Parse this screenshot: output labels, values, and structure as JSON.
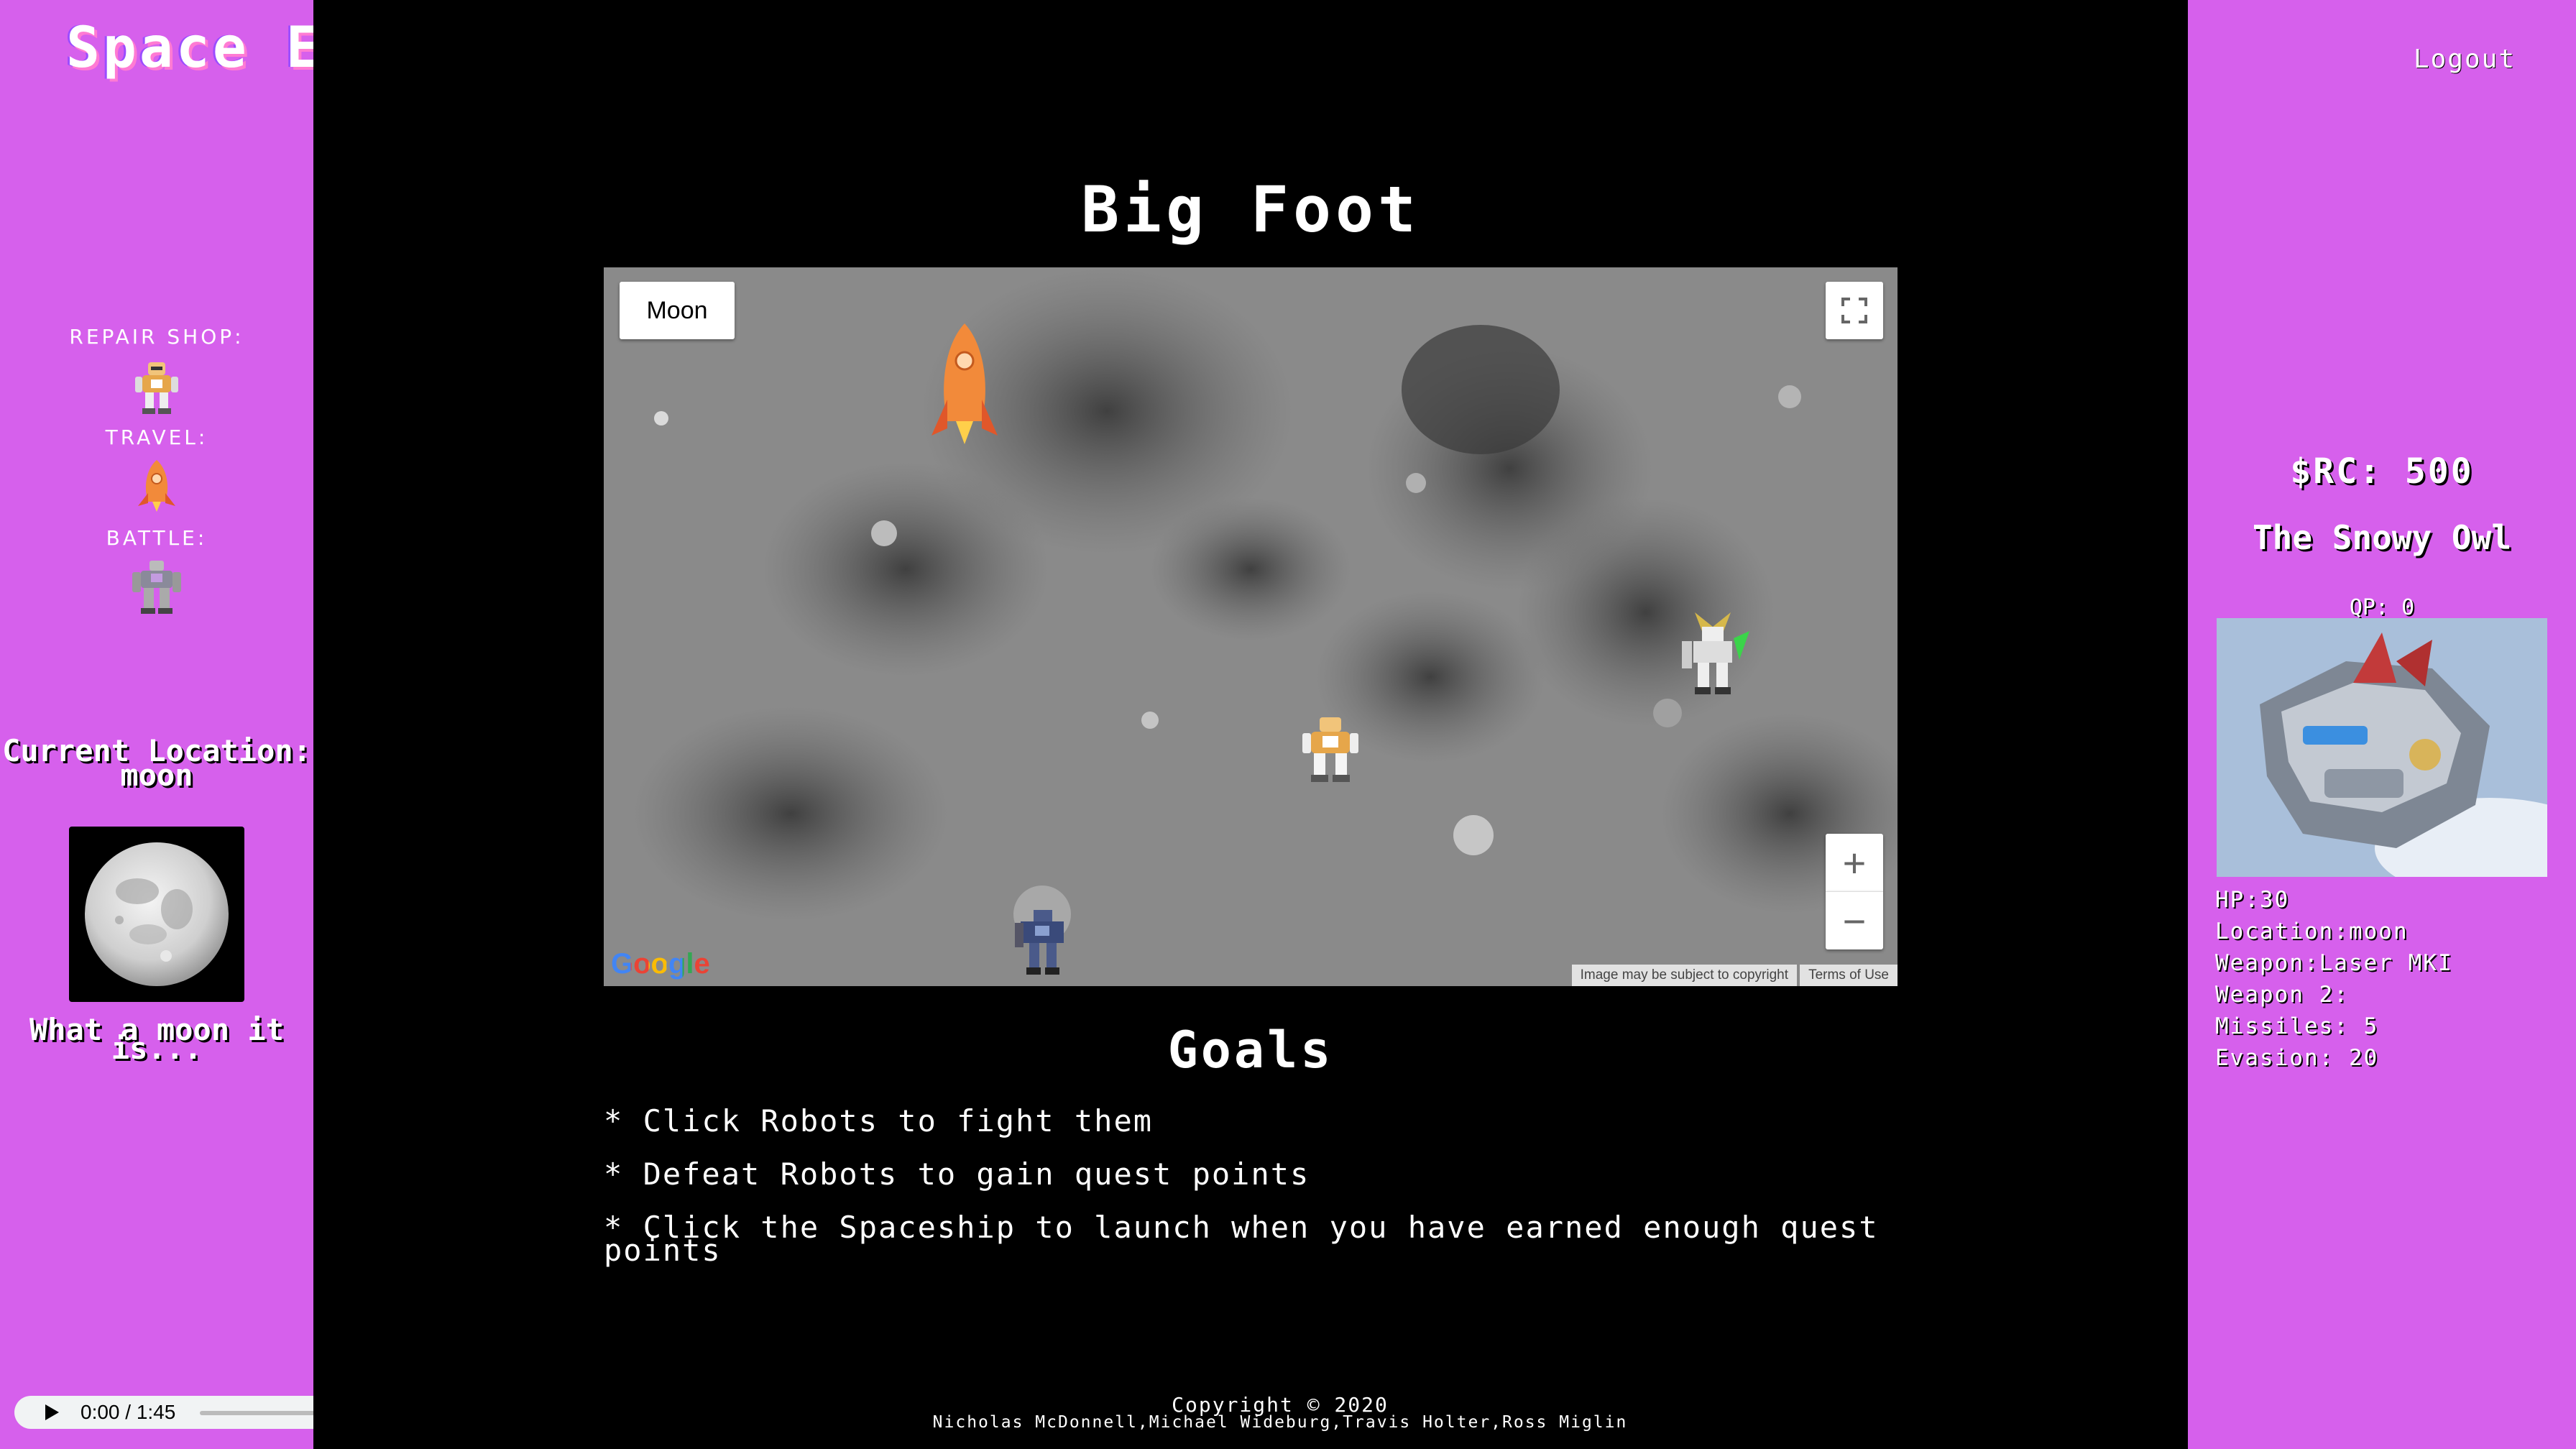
{
  "header": {
    "site_title": "Space Explorers",
    "logout_label": "Logout"
  },
  "sidebar": {
    "repair_label": "REPAIR SHOP:",
    "travel_label": "TRAVEL:",
    "battle_label": "BATTLE:",
    "location_title": "Current Location: moon",
    "tagline": "What a moon it is..."
  },
  "audio": {
    "time": "0:00 / 1:45"
  },
  "main": {
    "heading": "Big Foot",
    "goals_heading": "Goals",
    "goals": [
      "* Click Robots to fight them",
      "* Defeat Robots to gain quest points",
      "* Click the Spaceship to launch when you have earned enough quest points"
    ]
  },
  "map": {
    "type_button": "Moon",
    "google_logo": "Google",
    "copyright_notice": "Image may be subject to copyright",
    "terms": "Terms of Use",
    "zoom_in": "+",
    "zoom_out": "−"
  },
  "footer": {
    "copyright": "Copyright © 2020",
    "authors": "Nicholas McDonnell,Michael Wideburg,Travis Holter,Ross Miglin"
  },
  "player": {
    "rc": "$RC: 500",
    "robot_name": "The Snowy Owl",
    "qp": "QP: 0",
    "stats": [
      "HP:30",
      "Location:moon",
      "Weapon:Laser MKI",
      "Weapon 2:",
      "Missiles: 5",
      "Evasion: 20"
    ]
  },
  "colors": {
    "panel_bg": "#d660ec",
    "main_bg": "#000000",
    "text": "#ffffff"
  },
  "icons": [
    "repair-robot-icon",
    "rocket-icon",
    "battle-robot-icon",
    "fullscreen-icon"
  ]
}
